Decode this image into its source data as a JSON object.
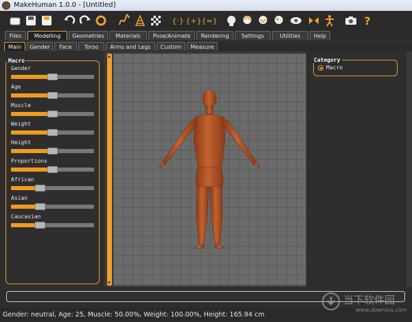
{
  "window": {
    "title": "MakeHuman 1.0.0 - [Untitled]"
  },
  "toolbar": {
    "icons": [
      "new-file-icon",
      "save-icon",
      "export-icon",
      "undo-icon",
      "redo-icon",
      "reset-icon",
      "smooth-icon",
      "wireframe-icon",
      "background-icon",
      "front-view-icon",
      "side-view-icon",
      "top-view-icon",
      "head-front-icon",
      "head-side-icon",
      "head-top-icon",
      "eye-icon",
      "pose-icon",
      "skeleton-icon",
      "screenshot-icon",
      "help-icon"
    ]
  },
  "main_tabs": [
    "Files",
    "Modelling",
    "Geometries",
    "Materials",
    "Pose/Animate",
    "Rendering",
    "Settings",
    "Utilities",
    "Help"
  ],
  "main_tab_active": "Modelling",
  "sub_tabs": [
    "Main",
    "Gender",
    "Face",
    "Torso",
    "Arms and Legs",
    "Custom",
    "Measure"
  ],
  "sub_tab_active": "Main",
  "macro": {
    "title": "Macro",
    "sliders": [
      {
        "label": "Gender",
        "value": 0.5
      },
      {
        "label": "Age",
        "value": 0.5
      },
      {
        "label": "Muscle",
        "value": 0.5
      },
      {
        "label": "Weight",
        "value": 0.5
      },
      {
        "label": "Height",
        "value": 0.5
      },
      {
        "label": "Proportions",
        "value": 0.5
      },
      {
        "label": "African",
        "value": 0.33
      },
      {
        "label": "Asian",
        "value": 0.33
      },
      {
        "label": "Caucasian",
        "value": 0.33
      }
    ]
  },
  "category": {
    "title": "Category",
    "options": [
      {
        "label": "Macro",
        "selected": true
      }
    ]
  },
  "status": "Gender: neutral, Age: 25, Muscle: 50.00%, Weight: 100.00%, Height: 165.94 cm",
  "watermark": {
    "text": "当下软件园",
    "url": "www.downxia.com"
  },
  "colors": {
    "accent": "#f0a030",
    "skin": "#b8552a",
    "background": "#3a3a3a"
  }
}
